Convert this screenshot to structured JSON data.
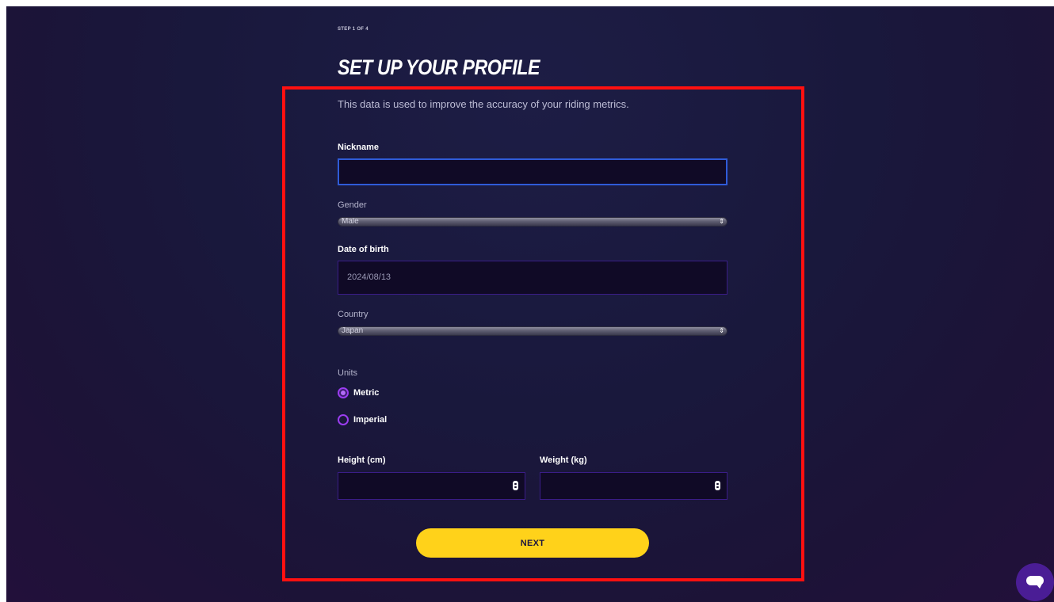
{
  "header": {
    "step_indicator": "STEP 1 OF 4",
    "title": "SET UP YOUR PROFILE"
  },
  "form": {
    "intro": "This data is used to improve the accuracy of your riding metrics.",
    "nickname": {
      "label": "Nickname",
      "value": ""
    },
    "gender": {
      "label": "Gender",
      "selected": "Male"
    },
    "date_of_birth": {
      "label": "Date of birth",
      "value": "2024/08/13"
    },
    "country": {
      "label": "Country",
      "selected": "Japan"
    },
    "units": {
      "label": "Units",
      "options": [
        {
          "label": "Metric",
          "checked": true
        },
        {
          "label": "Imperial",
          "checked": false
        }
      ]
    },
    "height": {
      "label": "Height (cm)",
      "value": ""
    },
    "weight": {
      "label": "Weight (kg)",
      "value": ""
    },
    "next_label": "NEXT"
  },
  "icons": {
    "chat": "chat-bubble-icon",
    "select_arrows": "updown-arrows-icon",
    "number_spinner": "spinner-icon"
  },
  "colors": {
    "accent_yellow": "#ffd21a",
    "radio_purple": "#9b3df0",
    "focus_blue": "#2f5bd8",
    "highlight_red": "#ff1010"
  }
}
